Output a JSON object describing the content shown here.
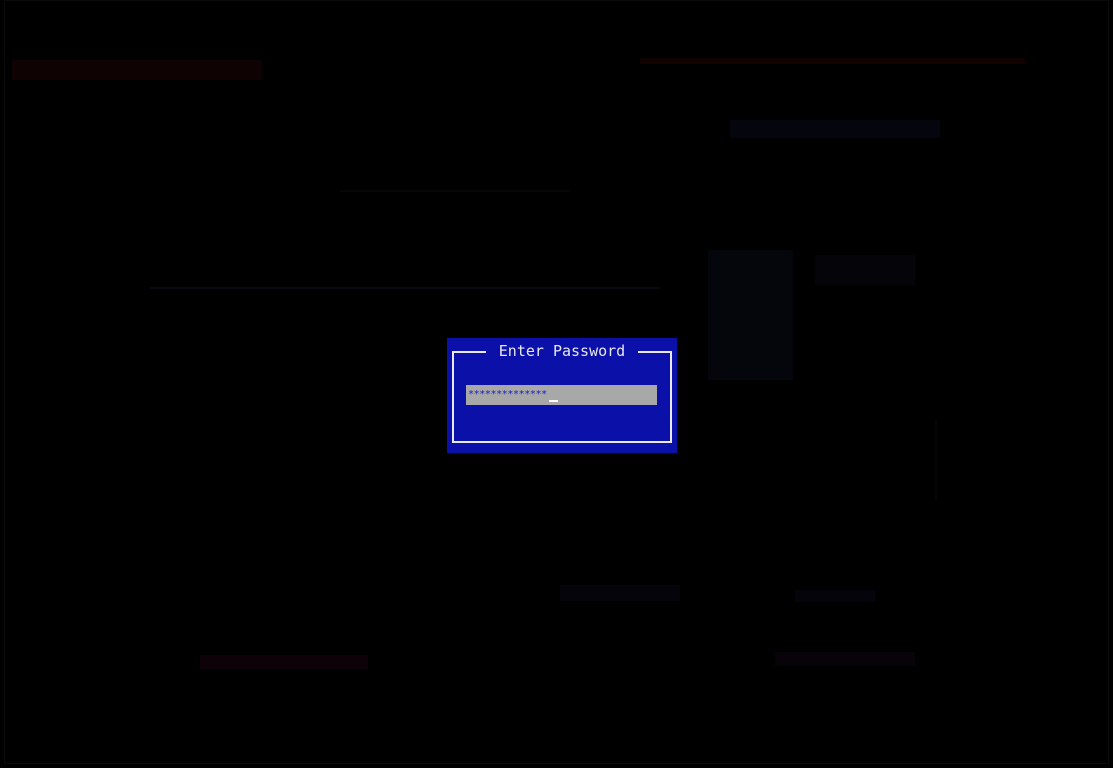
{
  "dialog": {
    "title": "Enter Password",
    "password_value": "**************",
    "colors": {
      "background": "#0b10a8",
      "frame": "#e8e8f0",
      "field_background": "#a8a8a8",
      "field_text": "#1a22b8"
    }
  },
  "screen": {
    "background": "#000000"
  }
}
